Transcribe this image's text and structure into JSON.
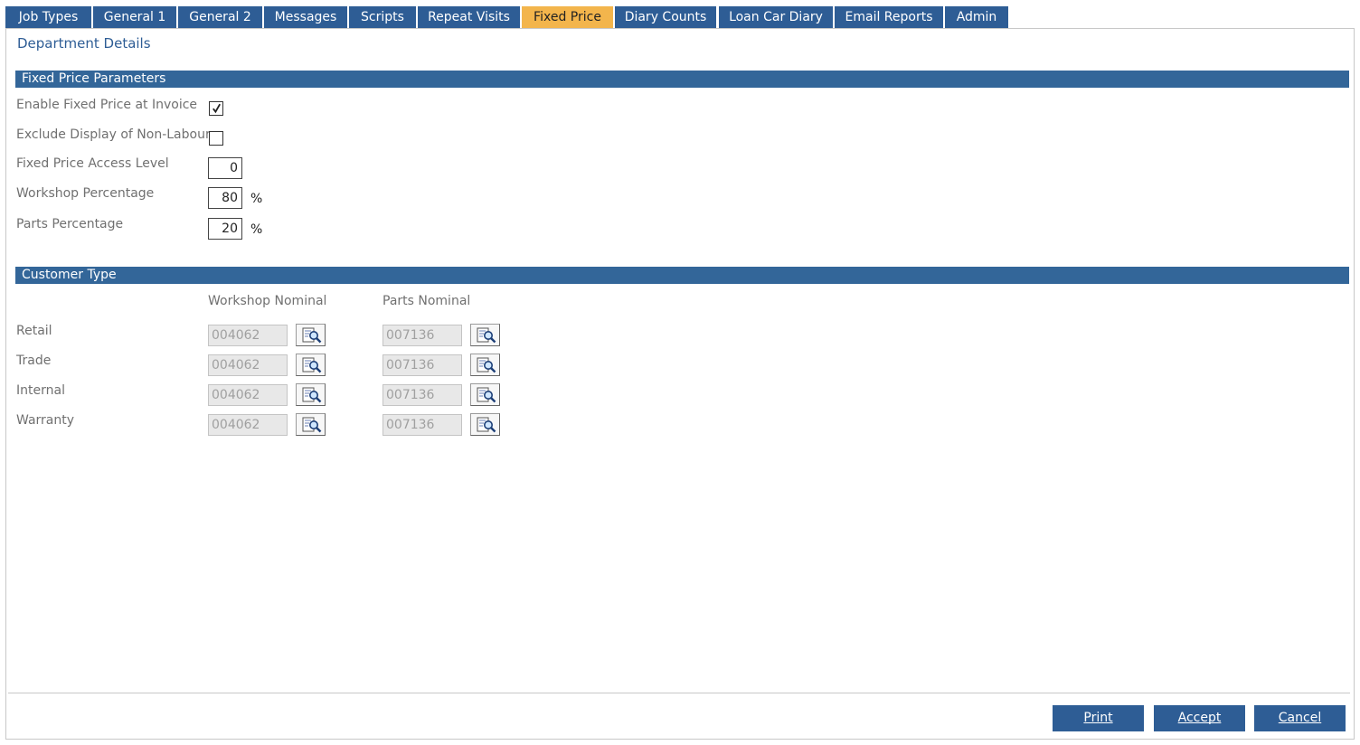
{
  "tabs": [
    {
      "label": "Job Types",
      "active": false
    },
    {
      "label": "General 1",
      "active": false
    },
    {
      "label": "General 2",
      "active": false
    },
    {
      "label": "Messages",
      "active": false
    },
    {
      "label": "Scripts",
      "active": false
    },
    {
      "label": "Repeat Visits",
      "active": false
    },
    {
      "label": "Fixed Price",
      "active": true
    },
    {
      "label": "Diary Counts",
      "active": false
    },
    {
      "label": "Loan Car Diary",
      "active": false
    },
    {
      "label": "Email Reports",
      "active": false
    },
    {
      "label": "Admin",
      "active": false
    }
  ],
  "page_title": "Department Details",
  "fixed_price": {
    "section_title": "Fixed Price Parameters",
    "enable_label": "Enable Fixed Price at Invoice",
    "enable_checked": true,
    "exclude_label": "Exclude Display of Non-Labour",
    "exclude_checked": false,
    "access_label": "Fixed Price Access Level",
    "access_value": "0",
    "workshop_label": "Workshop Percentage",
    "workshop_value": "80",
    "workshop_unit": "%",
    "parts_label": "Parts Percentage",
    "parts_value": "20",
    "parts_unit": "%"
  },
  "customer_type": {
    "section_title": "Customer Type",
    "workshop_header": "Workshop Nominal",
    "parts_header": "Parts Nominal",
    "rows": [
      {
        "label": "Retail",
        "workshop": "004062",
        "parts": "007136"
      },
      {
        "label": "Trade",
        "workshop": "004062",
        "parts": "007136"
      },
      {
        "label": "Internal",
        "workshop": "004062",
        "parts": "007136"
      },
      {
        "label": "Warranty",
        "workshop": "004062",
        "parts": "007136"
      }
    ]
  },
  "buttons": {
    "print": "Print",
    "accept": "Accept",
    "cancel": "Cancel"
  },
  "colors": {
    "tab": "#2e5d95",
    "tab_active": "#f3b54c",
    "section_bar": "#336699",
    "button": "#2e5d95"
  },
  "icons": {
    "lookup": "document-magnifier-icon",
    "check": "checkmark-icon"
  }
}
